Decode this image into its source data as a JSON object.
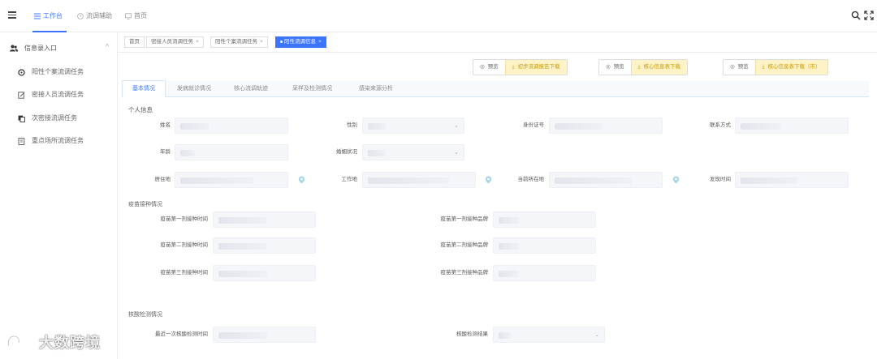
{
  "topbar": {
    "tabs": [
      {
        "label": "工作台",
        "icon": "list-icon"
      },
      {
        "label": "流调辅助",
        "icon": "clock-icon"
      },
      {
        "label": "首页",
        "icon": "monitor-icon"
      }
    ]
  },
  "sidebar": {
    "group_label": "信息录入口",
    "items": [
      {
        "label": "阳性个案流调任务"
      },
      {
        "label": "密接人员流调任务"
      },
      {
        "label": "次密接流调任务"
      },
      {
        "label": "重点场所流调任务"
      }
    ]
  },
  "breadcrumbs": [
    {
      "label": "首页",
      "closable": false
    },
    {
      "label": "密接人员流调任务",
      "closable": true
    },
    {
      "label": "阳性个案流调任务",
      "closable": true
    },
    {
      "label": "阳性流调信息",
      "closable": true,
      "active": true
    }
  ],
  "actions": [
    {
      "preview": "预览",
      "download": "初步流调报告下载"
    },
    {
      "preview": "预览",
      "download": "核心信息表下载"
    },
    {
      "preview": "预览",
      "download": "核心信息表下载（市）"
    }
  ],
  "tabs": [
    "基本情况",
    "发病就诊情况",
    "核心流调轨迹",
    "采样及检测情况",
    "感染来源分析"
  ],
  "personal": {
    "title": "个人信息",
    "name": "姓名",
    "gender": "性别",
    "id_card": "身份证号",
    "contact": "联系方式",
    "age": "年龄",
    "marital": "婚姻状况",
    "residence": "居住地",
    "workplace": "工作地",
    "current_location": "当前所在地",
    "discovery_time": "发现时间"
  },
  "vaccine": {
    "title": "疫苗接种情况",
    "dose1_time": "疫苗第一剂接种时间",
    "dose1_brand": "疫苗第一剂接种品牌",
    "dose2_time": "疫苗第二剂接种时间",
    "dose2_brand": "疫苗第二剂接种品牌",
    "dose3_time": "疫苗第三剂接种时间",
    "dose3_brand": "疫苗第三剂接种品牌"
  },
  "nucleic": {
    "title": "核酸检测情况",
    "last_test_time": "最近一次核酸检测时间",
    "result": "核酸检测结果"
  },
  "watermark": {
    "text": "大数跨境"
  },
  "colors": {
    "accent": "#3b74ff",
    "download_bg": "#fdf3c6",
    "download_text": "#c99a00"
  }
}
